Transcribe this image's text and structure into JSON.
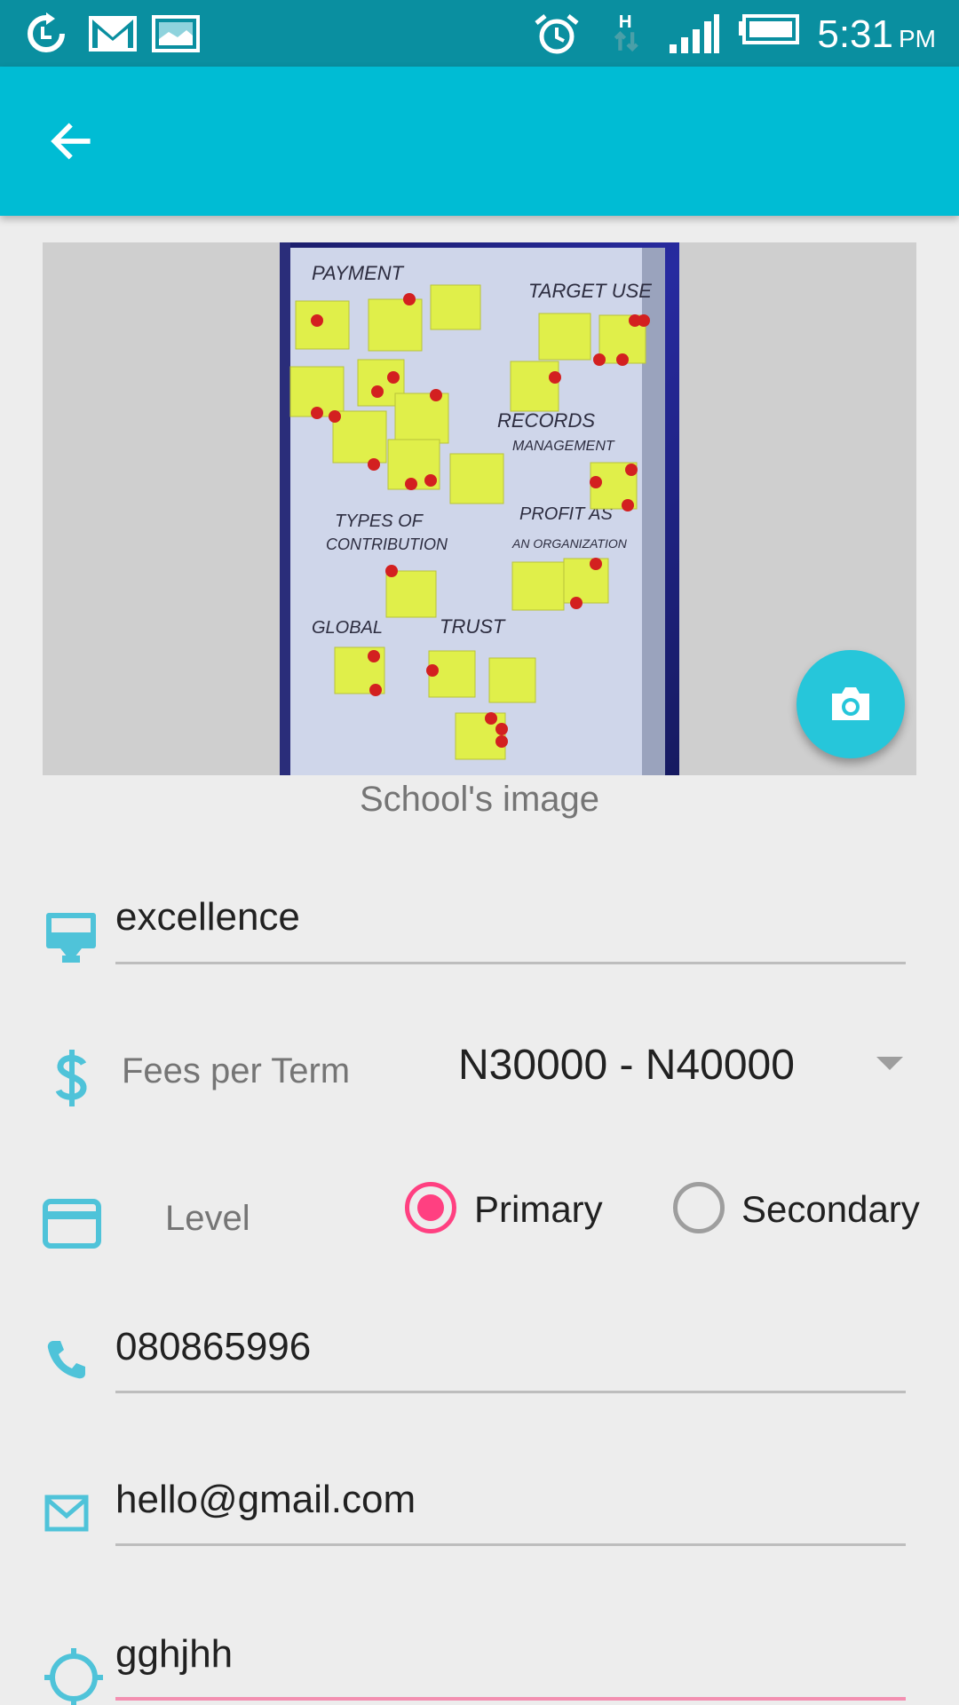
{
  "status_bar": {
    "time": "5:31",
    "ampm": "PM",
    "icons": [
      "sync-icon",
      "gmail-icon",
      "gallery-icon",
      "alarm-icon",
      "network-h-icon",
      "signal-icon",
      "battery-icon"
    ]
  },
  "app_bar": {
    "back_icon": "arrow-back-icon"
  },
  "school_image": {
    "caption": "School's image",
    "camera_icon": "camera-icon",
    "board_text": {
      "payment": "PAYMENT",
      "target": "TARGET USE",
      "records": "RECORDS",
      "management": "MANAGEMENT",
      "types": "TYPES OF",
      "contribution": "CONTRIBUTION",
      "profit": "PROFIT AS",
      "organization": "AN ORGANIZATION",
      "global": "GLOBAL",
      "trust": "TRUST"
    }
  },
  "form": {
    "name": {
      "value": "excellence",
      "icon": "school-sign-icon"
    },
    "fees": {
      "label": "Fees per Term",
      "selected": "N30000 - N40000",
      "icon": "dollar-icon"
    },
    "level": {
      "label": "Level",
      "icon": "card-icon",
      "options": [
        {
          "label": "Primary",
          "checked": true
        },
        {
          "label": "Secondary",
          "checked": false
        }
      ]
    },
    "phone": {
      "value": "080865996",
      "icon": "phone-icon"
    },
    "email": {
      "value": "hello@gmail.com",
      "icon": "email-icon"
    },
    "location": {
      "value": "gghjhh",
      "icon": "location-icon"
    }
  },
  "colors": {
    "status_bar": "#0a8fa0",
    "app_bar": "#00bcd4",
    "fab": "#26c6da",
    "icon_tint": "#4fc3d9",
    "accent": "#ff4081"
  }
}
